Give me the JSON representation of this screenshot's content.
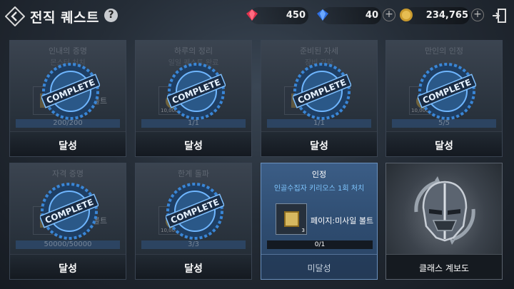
{
  "header": {
    "title": "전직 퀘스트",
    "help_label": "?",
    "red_gem_value": "450",
    "blue_gem_value": "40",
    "gold_value": "234,765",
    "plus_label": "+"
  },
  "completed_quests": [
    {
      "title": "인내의 증명",
      "subtitle": "몬스터 처치",
      "item_name": "미사일 볼트",
      "item_qty": "",
      "progress": "200/200",
      "status": "달성"
    },
    {
      "title": "하루의 정리",
      "subtitle": "일일 퀘스트 완료",
      "item_name": "",
      "item_qty": "10,000",
      "progress": "1/1",
      "status": "달성"
    },
    {
      "title": "준비된 자세",
      "subtitle": "장비 강화",
      "item_name": "",
      "item_qty": "",
      "progress": "1/1",
      "status": "달성"
    },
    {
      "title": "만인의 인정",
      "subtitle": "",
      "item_name": "",
      "item_qty": "10,000",
      "progress": "5/5",
      "status": "달성"
    },
    {
      "title": "자격 증명",
      "subtitle": "",
      "item_name": "미사일 볼트",
      "item_qty": "",
      "progress": "50000/50000",
      "status": "달성"
    },
    {
      "title": "한계 돌파",
      "subtitle": "",
      "item_name": "",
      "item_qty": "10,000",
      "progress": "3/3",
      "status": "달성"
    }
  ],
  "stamp_text": "COMPLETE",
  "active_quest": {
    "title": "인정",
    "objective": "인골수집자 키리오스 1회 처치",
    "item_name": "페이지:미사일 볼트",
    "item_qty": "3",
    "progress": "0/1",
    "status": "미달성"
  },
  "class_card": {
    "label": "클래스 계보도"
  }
}
